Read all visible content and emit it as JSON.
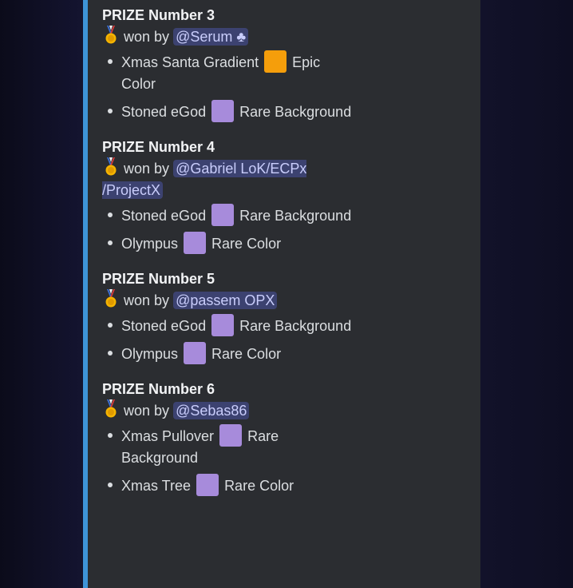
{
  "prizes": [
    {
      "title": "PRIZE Number 3",
      "won_by": "won by",
      "winner": "@Serum ♣",
      "items": [
        {
          "name": "Xmas Santa Gradient",
          "color": "#f59e0b",
          "rarity": "Epic Color"
        },
        {
          "name": "Stoned eGod",
          "color": "#a78bdb",
          "rarity": "Rare Background"
        }
      ]
    },
    {
      "title": "PRIZE Number 4",
      "won_by": "won by",
      "winner": "@Gabriel LoK/ECPx /ProjectX",
      "items": [
        {
          "name": "Stoned eGod",
          "color": "#a78bdb",
          "rarity": "Rare Background"
        },
        {
          "name": "Olympus",
          "color": "#a78bdb",
          "rarity": "Rare Color"
        }
      ]
    },
    {
      "title": "PRIZE Number 5",
      "won_by": "won by",
      "winner": "@passem OPX",
      "items": [
        {
          "name": "Stoned eGod",
          "color": "#a78bdb",
          "rarity": "Rare Background"
        },
        {
          "name": "Olympus",
          "color": "#a78bdb",
          "rarity": "Rare Color"
        }
      ]
    },
    {
      "title": "PRIZE Number 6",
      "won_by": "won by",
      "winner": "@Sebas86",
      "items": [
        {
          "name": "Xmas Pullover",
          "color": "#a78bdb",
          "rarity": "Rare Background"
        },
        {
          "name": "Xmas Tree",
          "color": "#a78bdb",
          "rarity": "Rare Color"
        }
      ]
    }
  ],
  "icons": {
    "medal": "medal-icon"
  },
  "colors": {
    "accent": "#3e94d8",
    "mention_bg": "#3c4270",
    "embed_bg": "#2b2d31"
  }
}
